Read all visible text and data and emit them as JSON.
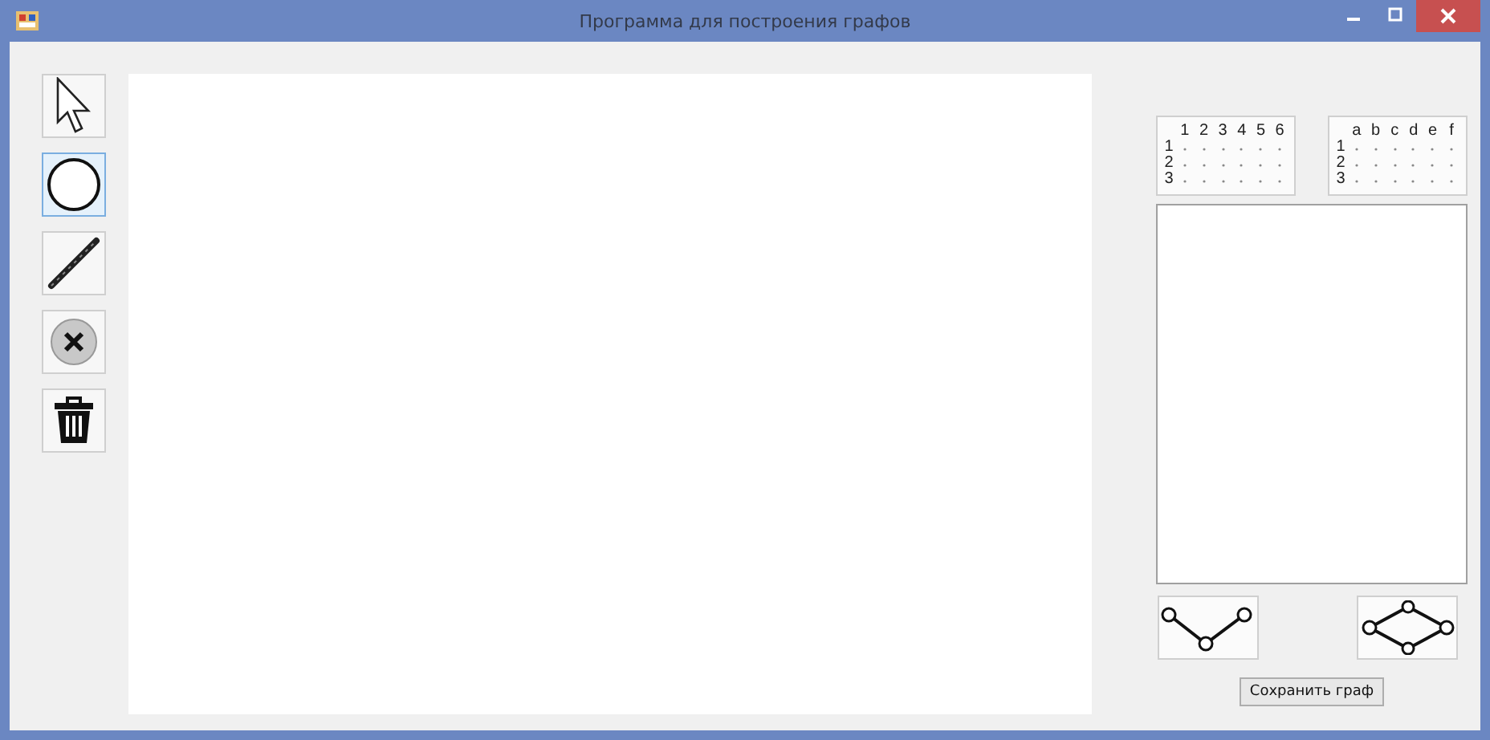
{
  "window": {
    "title": "Программа для построения графов"
  },
  "tools": [
    {
      "kind": "pointer",
      "selected": false
    },
    {
      "kind": "vertex",
      "selected": true
    },
    {
      "kind": "edge",
      "selected": false
    },
    {
      "kind": "delete",
      "selected": false
    },
    {
      "kind": "clear",
      "selected": false
    }
  ],
  "matrices": [
    {
      "columns": [
        "1",
        "2",
        "3",
        "4",
        "5",
        "6"
      ],
      "rows": [
        "1",
        "2",
        "3"
      ]
    },
    {
      "columns": [
        "a",
        "b",
        "c",
        "d",
        "e",
        "f"
      ],
      "rows": [
        "1",
        "2",
        "3"
      ]
    }
  ],
  "graph_buttons": [
    {
      "kind": "path"
    },
    {
      "kind": "cycle"
    }
  ],
  "save_button": "Сохранить граф"
}
